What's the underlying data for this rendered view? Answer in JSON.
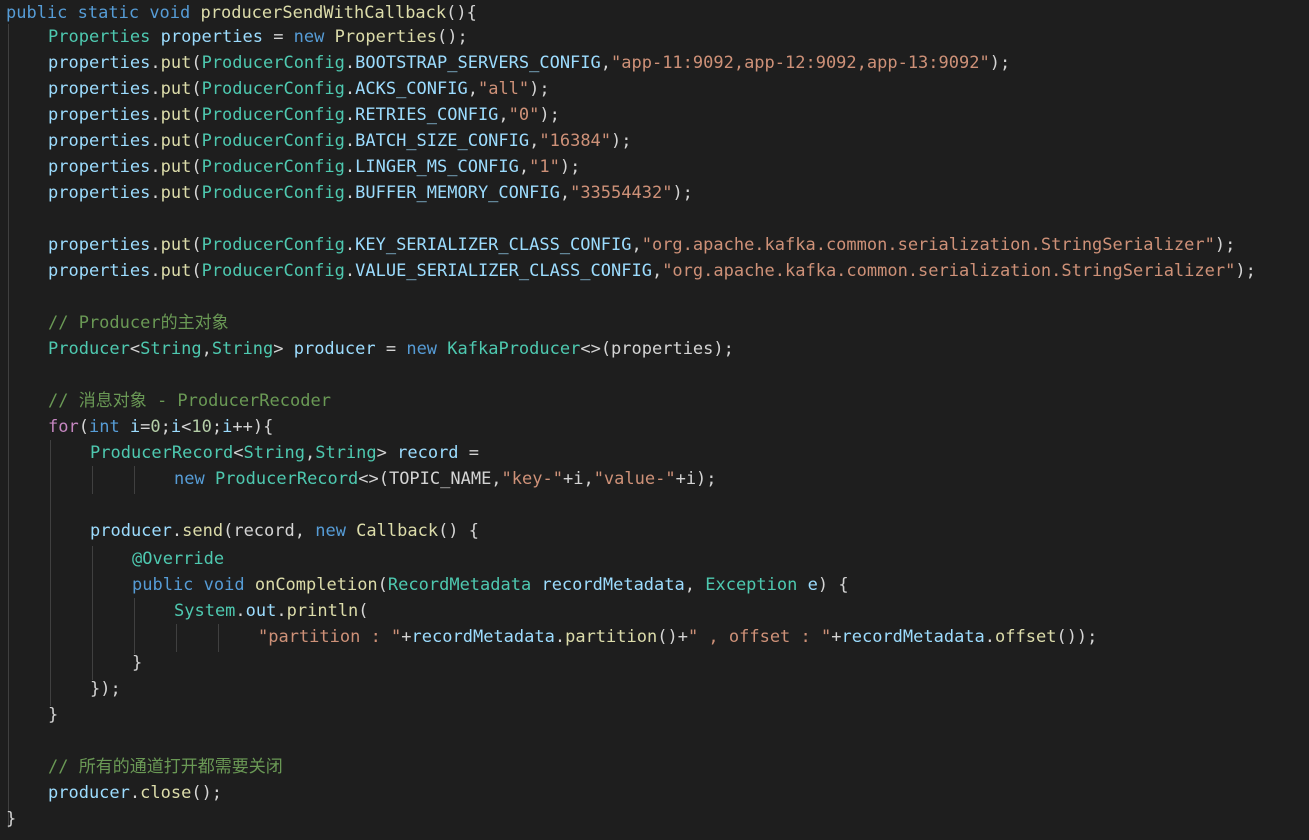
{
  "editor": {
    "theme": "dark",
    "background": "#1e1e1e",
    "lines": [
      [
        [
          "kw",
          "public "
        ],
        [
          "kw",
          "static "
        ],
        [
          "kw",
          "void "
        ],
        [
          "fn",
          "producerSendWithCallback"
        ],
        [
          "pun",
          "(){"
        ]
      ],
      [
        [
          "ty",
          "Properties "
        ],
        [
          "var",
          "properties "
        ],
        [
          "pun",
          "= "
        ],
        [
          "kw",
          "new "
        ],
        [
          "fn",
          "Properties"
        ],
        [
          "pun",
          "();"
        ]
      ],
      [
        [
          "var",
          "properties"
        ],
        [
          "pun",
          "."
        ],
        [
          "fn",
          "put"
        ],
        [
          "pun",
          "("
        ],
        [
          "ty",
          "ProducerConfig"
        ],
        [
          "pun",
          "."
        ],
        [
          "var",
          "BOOTSTRAP_SERVERS_CONFIG"
        ],
        [
          "pun",
          ","
        ],
        [
          "str",
          "\"app-11:9092,app-12:9092,app-13:9092\""
        ],
        [
          "pun",
          ");"
        ]
      ],
      [
        [
          "var",
          "properties"
        ],
        [
          "pun",
          "."
        ],
        [
          "fn",
          "put"
        ],
        [
          "pun",
          "("
        ],
        [
          "ty",
          "ProducerConfig"
        ],
        [
          "pun",
          "."
        ],
        [
          "var",
          "ACKS_CONFIG"
        ],
        [
          "pun",
          ","
        ],
        [
          "str",
          "\"all\""
        ],
        [
          "pun",
          ");"
        ]
      ],
      [
        [
          "var",
          "properties"
        ],
        [
          "pun",
          "."
        ],
        [
          "fn",
          "put"
        ],
        [
          "pun",
          "("
        ],
        [
          "ty",
          "ProducerConfig"
        ],
        [
          "pun",
          "."
        ],
        [
          "var",
          "RETRIES_CONFIG"
        ],
        [
          "pun",
          ","
        ],
        [
          "str",
          "\"0\""
        ],
        [
          "pun",
          ");"
        ]
      ],
      [
        [
          "var",
          "properties"
        ],
        [
          "pun",
          "."
        ],
        [
          "fn",
          "put"
        ],
        [
          "pun",
          "("
        ],
        [
          "ty",
          "ProducerConfig"
        ],
        [
          "pun",
          "."
        ],
        [
          "var",
          "BATCH_SIZE_CONFIG"
        ],
        [
          "pun",
          ","
        ],
        [
          "str",
          "\"16384\""
        ],
        [
          "pun",
          ");"
        ]
      ],
      [
        [
          "var",
          "properties"
        ],
        [
          "pun",
          "."
        ],
        [
          "fn",
          "put"
        ],
        [
          "pun",
          "("
        ],
        [
          "ty",
          "ProducerConfig"
        ],
        [
          "pun",
          "."
        ],
        [
          "var",
          "LINGER_MS_CONFIG"
        ],
        [
          "pun",
          ","
        ],
        [
          "str",
          "\"1\""
        ],
        [
          "pun",
          ");"
        ]
      ],
      [
        [
          "var",
          "properties"
        ],
        [
          "pun",
          "."
        ],
        [
          "fn",
          "put"
        ],
        [
          "pun",
          "("
        ],
        [
          "ty",
          "ProducerConfig"
        ],
        [
          "pun",
          "."
        ],
        [
          "var",
          "BUFFER_MEMORY_CONFIG"
        ],
        [
          "pun",
          ","
        ],
        [
          "str",
          "\"33554432\""
        ],
        [
          "pun",
          ");"
        ]
      ],
      [],
      [
        [
          "var",
          "properties"
        ],
        [
          "pun",
          "."
        ],
        [
          "fn",
          "put"
        ],
        [
          "pun",
          "("
        ],
        [
          "ty",
          "ProducerConfig"
        ],
        [
          "pun",
          "."
        ],
        [
          "var",
          "KEY_SERIALIZER_CLASS_CONFIG"
        ],
        [
          "pun",
          ","
        ],
        [
          "str",
          "\"org.apache.kafka.common.serialization.StringSerializer\""
        ],
        [
          "pun",
          ");"
        ]
      ],
      [
        [
          "var",
          "properties"
        ],
        [
          "pun",
          "."
        ],
        [
          "fn",
          "put"
        ],
        [
          "pun",
          "("
        ],
        [
          "ty",
          "ProducerConfig"
        ],
        [
          "pun",
          "."
        ],
        [
          "var",
          "VALUE_SERIALIZER_CLASS_CONFIG"
        ],
        [
          "pun",
          ","
        ],
        [
          "str",
          "\"org.apache.kafka.common.serialization.StringSerializer\""
        ],
        [
          "pun",
          ");"
        ]
      ],
      [],
      [
        [
          "cm",
          "// Producer的主对象"
        ]
      ],
      [
        [
          "ty",
          "Producer"
        ],
        [
          "pun",
          "<"
        ],
        [
          "ty",
          "String"
        ],
        [
          "pun",
          ","
        ],
        [
          "ty",
          "String"
        ],
        [
          "pun",
          "> "
        ],
        [
          "var",
          "producer "
        ],
        [
          "pun",
          "= "
        ],
        [
          "kw",
          "new "
        ],
        [
          "ty",
          "KafkaProducer"
        ],
        [
          "pun",
          "<>(properties);"
        ]
      ],
      [],
      [
        [
          "cm",
          "// 消息对象 - ProducerRecoder"
        ]
      ],
      [
        [
          "ctl",
          "for"
        ],
        [
          "pun",
          "("
        ],
        [
          "kw",
          "int "
        ],
        [
          "var",
          "i"
        ],
        [
          "pun",
          "="
        ],
        [
          "num",
          "0"
        ],
        [
          "pun",
          ";"
        ],
        [
          "var",
          "i"
        ],
        [
          "pun",
          "<"
        ],
        [
          "num",
          "10"
        ],
        [
          "pun",
          ";"
        ],
        [
          "var",
          "i"
        ],
        [
          "pun",
          "++){"
        ]
      ],
      [
        [
          "ty",
          "ProducerRecord"
        ],
        [
          "pun",
          "<"
        ],
        [
          "ty",
          "String"
        ],
        [
          "pun",
          ","
        ],
        [
          "ty",
          "String"
        ],
        [
          "pun",
          "> "
        ],
        [
          "var",
          "record "
        ],
        [
          "pun",
          "="
        ]
      ],
      [
        [
          "kw",
          "new "
        ],
        [
          "ty",
          "ProducerRecord"
        ],
        [
          "pun",
          "<>(TOPIC_NAME,"
        ],
        [
          "str",
          "\"key-\""
        ],
        [
          "pun",
          "+i,"
        ],
        [
          "str",
          "\"value-\""
        ],
        [
          "pun",
          "+i);"
        ]
      ],
      [],
      [
        [
          "var",
          "producer"
        ],
        [
          "pun",
          "."
        ],
        [
          "fn",
          "send"
        ],
        [
          "pun",
          "(record, "
        ],
        [
          "kw",
          "new "
        ],
        [
          "fn",
          "Callback"
        ],
        [
          "pun",
          "() {"
        ]
      ],
      [
        [
          "ann",
          "@Override"
        ]
      ],
      [
        [
          "kw",
          "public "
        ],
        [
          "kw",
          "void "
        ],
        [
          "fn",
          "onCompletion"
        ],
        [
          "pun",
          "("
        ],
        [
          "ty",
          "RecordMetadata "
        ],
        [
          "var",
          "recordMetadata"
        ],
        [
          "pun",
          ", "
        ],
        [
          "ty",
          "Exception "
        ],
        [
          "var",
          "e"
        ],
        [
          "pun",
          ") {"
        ]
      ],
      [
        [
          "ty",
          "System"
        ],
        [
          "pun",
          "."
        ],
        [
          "var",
          "out"
        ],
        [
          "pun",
          "."
        ],
        [
          "fn",
          "println"
        ],
        [
          "pun",
          "("
        ]
      ],
      [
        [
          "str",
          "\"partition : \""
        ],
        [
          "pun",
          "+"
        ],
        [
          "var",
          "recordMetadata"
        ],
        [
          "pun",
          "."
        ],
        [
          "fn",
          "partition"
        ],
        [
          "pun",
          "()+"
        ],
        [
          "str",
          "\" , offset : \""
        ],
        [
          "pun",
          "+"
        ],
        [
          "var",
          "recordMetadata"
        ],
        [
          "pun",
          "."
        ],
        [
          "fn",
          "offset"
        ],
        [
          "pun",
          "());"
        ]
      ],
      [
        [
          "pun",
          "}"
        ]
      ],
      [
        [
          "pun",
          "});"
        ]
      ],
      [
        [
          "pun",
          "}"
        ]
      ],
      [],
      [
        [
          "cm",
          "// 所有的通道打开都需要关闭"
        ]
      ],
      [
        [
          "var",
          "producer"
        ],
        [
          "pun",
          "."
        ],
        [
          "fn",
          "close"
        ],
        [
          "pun",
          "();"
        ]
      ],
      [
        [
          "pun",
          "}"
        ]
      ]
    ]
  }
}
